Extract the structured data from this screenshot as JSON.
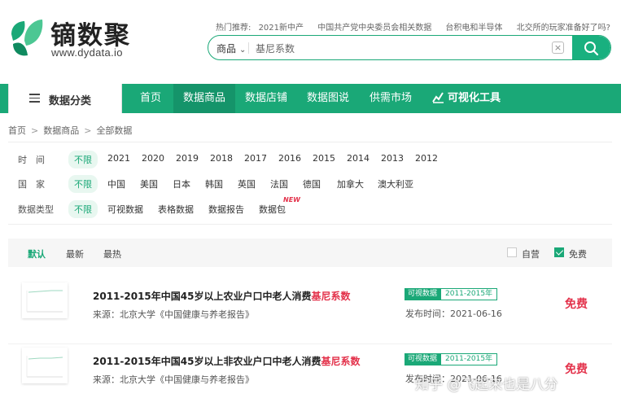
{
  "brand": {
    "name": "镝数聚",
    "url": "www.dydata.io",
    "accent": "#1aa877",
    "highlight": "#e3324b"
  },
  "hot": {
    "label": "热门推荐:",
    "items": [
      "2021新中产",
      "中国共产党中央委员会相关数据",
      "台积电和半导体",
      "北交所的玩家准备好了吗?"
    ]
  },
  "search": {
    "category": "商品",
    "value": "基尼系数",
    "clear_icon": "close-icon",
    "button_icon": "search-icon"
  },
  "nav": {
    "category_label": "数据分类",
    "items": [
      "首页",
      "数据商品",
      "数据店铺",
      "数据图说",
      "供需市场"
    ],
    "active": "数据商品",
    "tool_label": "可视化工具"
  },
  "breadcrumb": [
    "首页",
    "数据商品",
    "全部数据"
  ],
  "filters": {
    "time": {
      "label": "时　间",
      "options": [
        "不限",
        "2021",
        "2020",
        "2019",
        "2018",
        "2017",
        "2016",
        "2015",
        "2014",
        "2013",
        "2012"
      ]
    },
    "country": {
      "label": "国　家",
      "options": [
        "不限",
        "中国",
        "美国",
        "日本",
        "韩国",
        "英国",
        "法国",
        "德国",
        "加拿大",
        "澳大利亚"
      ]
    },
    "type": {
      "label": "数据类型",
      "options": [
        "不限",
        "可视数据",
        "表格数据",
        "数据报告",
        "数据包"
      ],
      "new_tag": "NEW"
    }
  },
  "sort": {
    "options": [
      "默认",
      "最新",
      "最热"
    ],
    "active": "默认",
    "checks": [
      {
        "label": "自营",
        "checked": false
      },
      {
        "label": "免费",
        "checked": true
      }
    ]
  },
  "results": [
    {
      "title_prefix": "2011-2015年中国45岁以上农业户口中老人消费",
      "title_highlight": "基尼系数",
      "source": "来源：北京大学《中国健康与养老报告》",
      "tag": "可视数据",
      "years": "2011-2015年",
      "date": "发布时间：2021-06-16",
      "price": "免费"
    },
    {
      "title_prefix": "2011-2015年中国45岁以上非农业户口中老人消费",
      "title_highlight": "基尼系数",
      "source": "来源：北京大学《中国健康与养老报告》",
      "tag": "可视数据",
      "years": "2011-2015年",
      "date": "发布时间：2021-06-16",
      "price": "免费"
    }
  ],
  "watermark": "知乎 @飞起来也是八分"
}
